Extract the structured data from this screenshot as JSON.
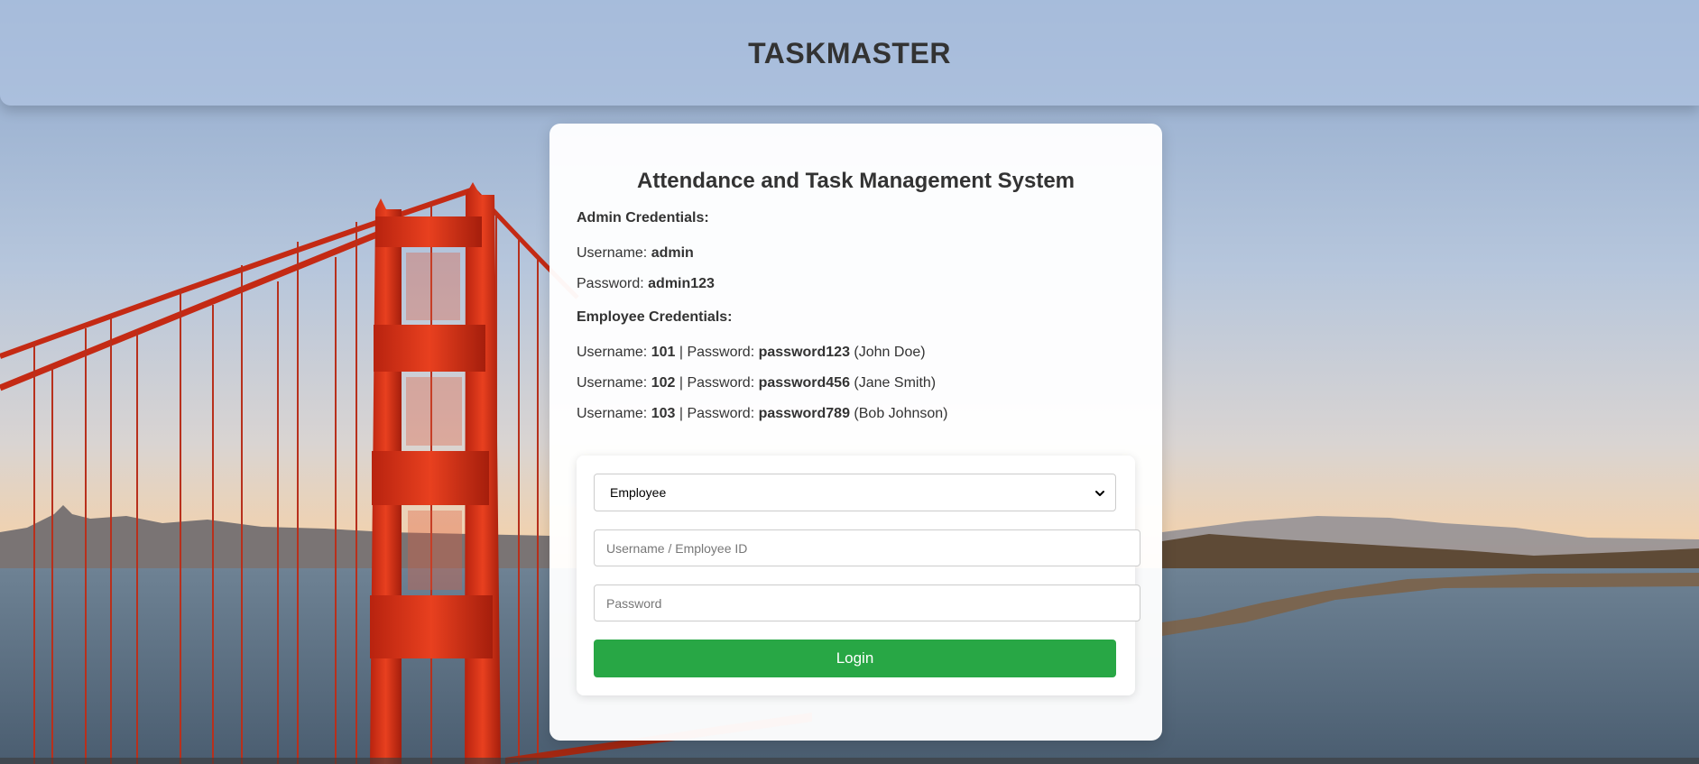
{
  "header": {
    "title": "TASKMASTER"
  },
  "card": {
    "title": "Attendance and Task Management System",
    "admin": {
      "heading": "Admin Credentials:",
      "username_label": "Username: ",
      "username": "admin",
      "password_label": "Password: ",
      "password": "admin123"
    },
    "employees": {
      "heading": "Employee Credentials:",
      "items": [
        {
          "username_label": "Username: ",
          "id": "101",
          "sep": " | Password: ",
          "password": "password123",
          "name": " (John Doe)"
        },
        {
          "username_label": "Username: ",
          "id": "102",
          "sep": " | Password: ",
          "password": "password456",
          "name": " (Jane Smith)"
        },
        {
          "username_label": "Username: ",
          "id": "103",
          "sep": " | Password: ",
          "password": "password789",
          "name": " (Bob Johnson)"
        }
      ]
    }
  },
  "form": {
    "role_select": {
      "value": "Employee",
      "icon": "chevron-down-icon"
    },
    "username_input": {
      "placeholder": "Username / Employee ID",
      "value": ""
    },
    "password_input": {
      "placeholder": "Password",
      "value": ""
    },
    "login_button": {
      "label": "Login"
    }
  },
  "colors": {
    "login_button": "#28a745",
    "header_bg": "#b0c4e0",
    "bridge": "#d7311a"
  }
}
